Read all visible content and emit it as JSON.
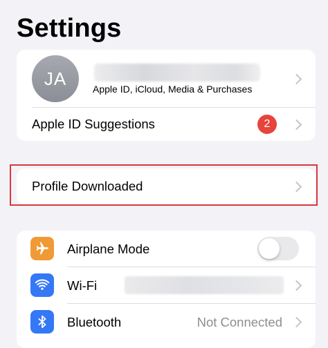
{
  "header": {
    "title": "Settings"
  },
  "account": {
    "initials": "JA",
    "subtitle": "Apple ID, iCloud, Media & Purchases",
    "suggestions_label": "Apple ID Suggestions",
    "suggestions_badge": "2"
  },
  "profile": {
    "label": "Profile Downloaded"
  },
  "settings": {
    "items": [
      {
        "label": "Airplane Mode",
        "icon": "airplane-icon",
        "icon_color": "#f09a37",
        "toggle_on": false
      },
      {
        "label": "Wi-Fi",
        "icon": "wifi-icon",
        "icon_color": "#3478f6"
      },
      {
        "label": "Bluetooth",
        "icon": "bluetooth-icon",
        "icon_color": "#3478f6",
        "value": "Not Connected"
      }
    ]
  },
  "colors": {
    "badge": "#e5453c",
    "highlight": "#d9363e",
    "background": "#f2f2f7"
  }
}
